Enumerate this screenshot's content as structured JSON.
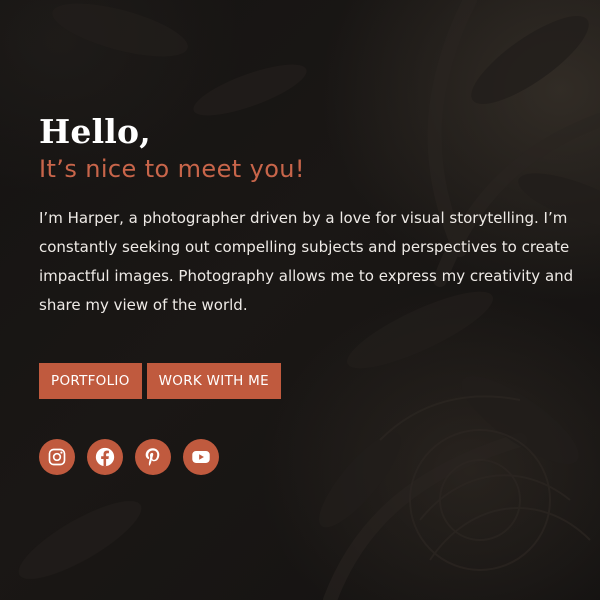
{
  "hero": {
    "title": "Hello,",
    "subtitle": "It’s nice to meet you!",
    "bio": "I’m Harper, a photographer driven by a love for visual storytelling. I’m constantly seeking out compelling subjects and perspectives to create impactful images. Photography allows me to express my creativity and share my view of the world."
  },
  "buttons": {
    "portfolio_label": "PORTFOLIO",
    "work_label": "WORK WITH ME"
  },
  "socials": [
    {
      "icon": "instagram-icon"
    },
    {
      "icon": "facebook-icon"
    },
    {
      "icon": "pinterest-icon"
    },
    {
      "icon": "youtube-icon"
    }
  ],
  "colors": {
    "accent": "#c05a3e",
    "subtitle": "#c8654a",
    "background": "#131111",
    "text": "#eeeae6"
  }
}
